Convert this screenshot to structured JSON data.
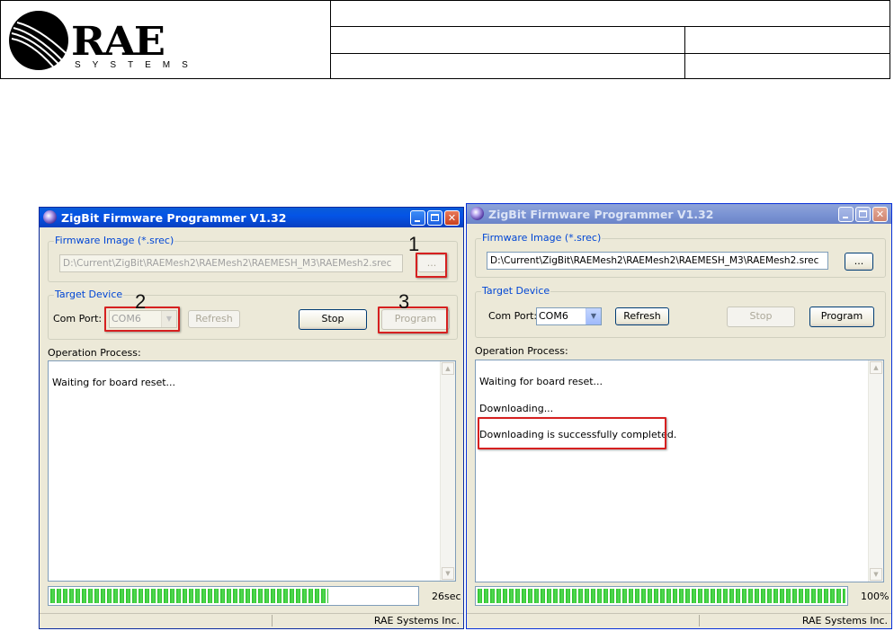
{
  "document_header": {
    "logo_main": "RAE",
    "logo_sub": "SYSTEMS"
  },
  "colors": {
    "annotation": "#d62020",
    "progress": "#2ac02a",
    "group_label": "#0046d5"
  },
  "left_window": {
    "title": "ZigBit Firmware Programmer V1.32",
    "firmware_group_label": "Firmware Image (*.srec)",
    "firmware_path": "D:\\Current\\ZigBit\\RAEMesh2\\RAEMesh2\\RAEMESH_M3\\RAEMesh2.srec",
    "browse_label": "...",
    "target_group_label": "Target Device",
    "com_port_label": "Com Port:",
    "com_port_value": "COM6",
    "refresh_label": "Refresh",
    "stop_label": "Stop",
    "program_label": "Program",
    "operation_label": "Operation Process:",
    "log_lines": [
      "Waiting for board reset..."
    ],
    "progress_value": 0.76,
    "progress_text": "26sec",
    "status_text": "RAE Systems Inc.",
    "annotations": [
      "1",
      "2",
      "3"
    ]
  },
  "right_window": {
    "title": "ZigBit Firmware Programmer V1.32",
    "firmware_group_label": "Firmware Image (*.srec)",
    "firmware_path": "D:\\Current\\ZigBit\\RAEMesh2\\RAEMesh2\\RAEMESH_M3\\RAEMesh2.srec",
    "browse_label": "...",
    "target_group_label": "Target Device",
    "com_port_label": "Com Port:",
    "com_port_value": "COM6",
    "refresh_label": "Refresh",
    "stop_label": "Stop",
    "program_label": "Program",
    "operation_label": "Operation Process:",
    "log_lines": [
      "Waiting for board reset...",
      "Downloading...",
      "Downloading is successfully completed."
    ],
    "progress_value": 1.0,
    "progress_text": "100%",
    "status_text": "RAE Systems Inc."
  }
}
